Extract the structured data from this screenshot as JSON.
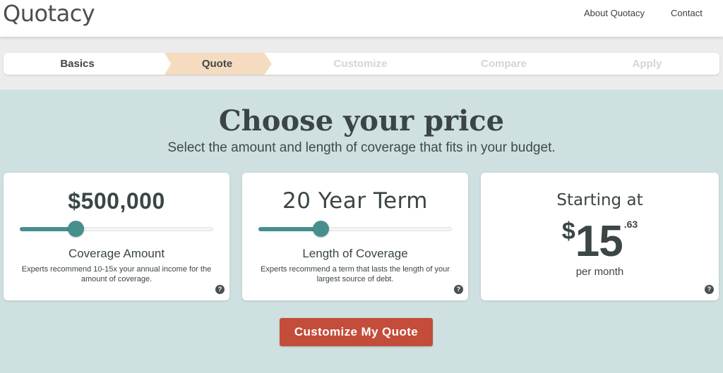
{
  "header": {
    "logo": "Quotacy",
    "nav": [
      {
        "label": "About Quotacy"
      },
      {
        "label": "Contact"
      }
    ]
  },
  "steps": [
    {
      "label": "Basics",
      "state": "done"
    },
    {
      "label": "Quote",
      "state": "current"
    },
    {
      "label": "Customize",
      "state": "upcoming"
    },
    {
      "label": "Compare",
      "state": "upcoming"
    },
    {
      "label": "Apply",
      "state": "upcoming"
    }
  ],
  "main": {
    "title": "Choose your price",
    "subtitle": "Select the amount and length of coverage that fits in your budget."
  },
  "coverage": {
    "value": "$500,000",
    "slider_fraction": 0.29,
    "label": "Coverage Amount",
    "help": "Experts recommend 10-15x your annual income for the amount of coverage.",
    "help_icon": "?"
  },
  "term": {
    "value": "20 Year Term",
    "slider_fraction": 0.32,
    "label": "Length of Coverage",
    "help": "Experts recommend a term that lasts the length of your largest source of debt.",
    "help_icon": "?"
  },
  "price": {
    "starting": "Starting at",
    "currency": "$",
    "dollars": "15",
    "cents": ".63",
    "period": "per month",
    "help_icon": "?"
  },
  "cta": {
    "label": "Customize My Quote"
  },
  "colors": {
    "accent": "#468f8c",
    "cta": "#c44c3a",
    "active_step": "#f5dcc0",
    "background": "#cfe0e0"
  }
}
